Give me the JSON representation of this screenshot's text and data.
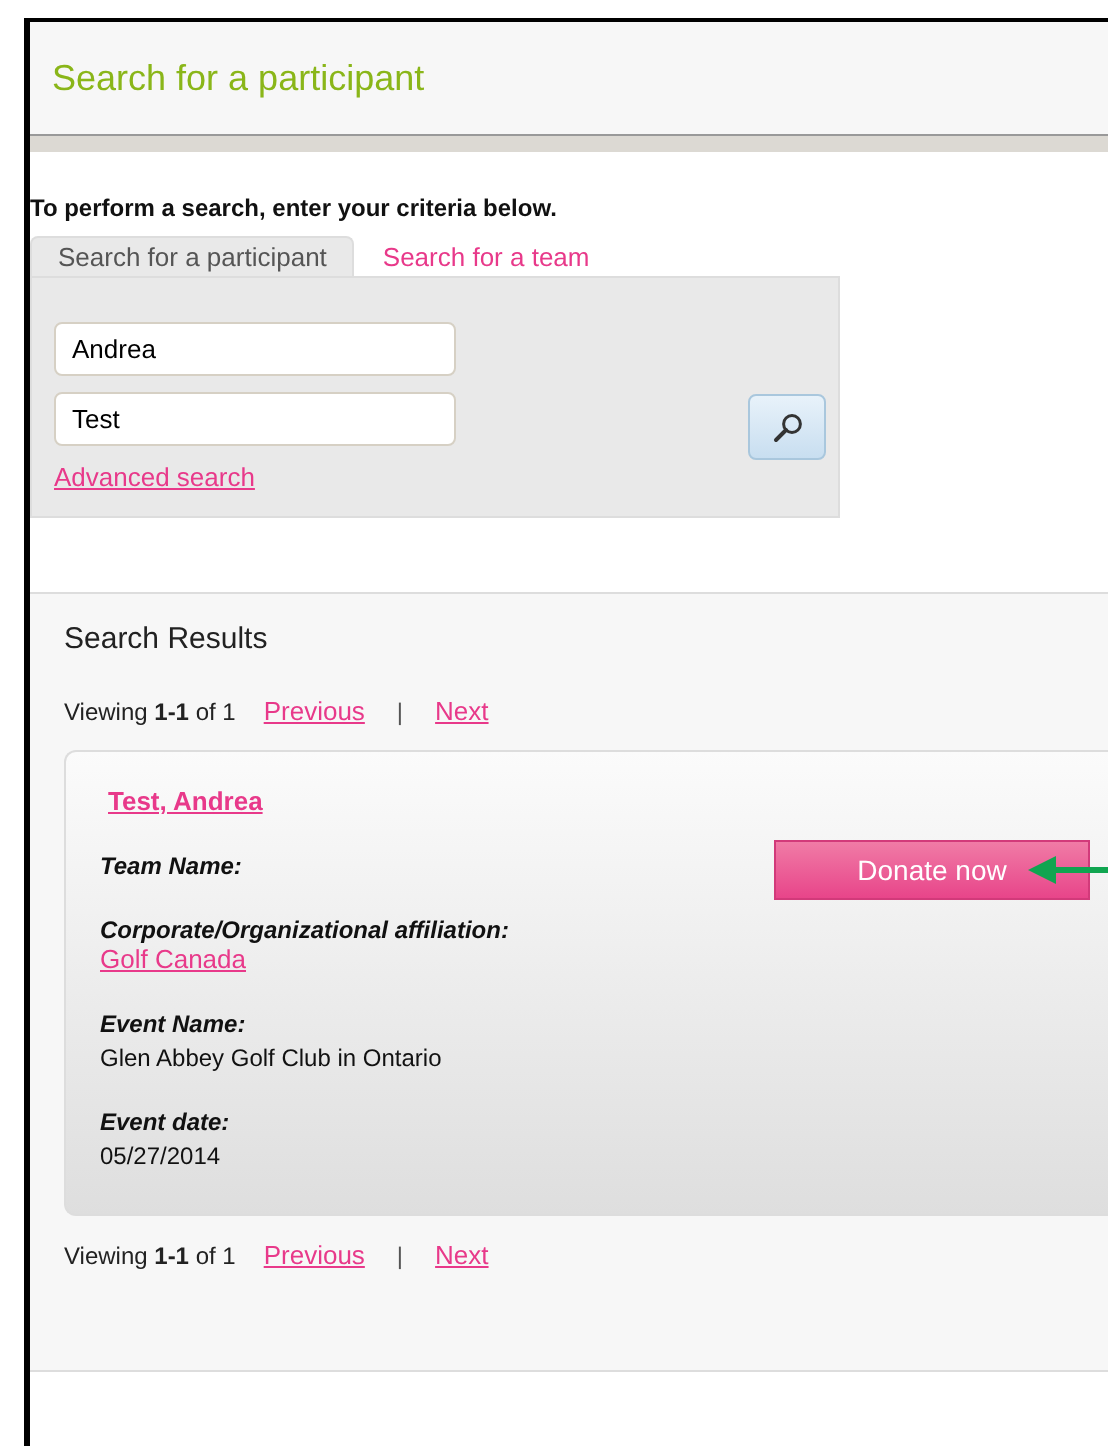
{
  "page_title": "Search for a participant",
  "instructions": "To perform a search, enter your criteria below.",
  "tabs": [
    {
      "label": "Search for a participant",
      "selected": true
    },
    {
      "label": "Search for a team",
      "selected": false
    }
  ],
  "search_form": {
    "first_name": {
      "value": "Andrea"
    },
    "last_name": {
      "value": "Test"
    },
    "advanced_link": "Advanced search"
  },
  "results": {
    "title": "Search Results",
    "pagination_top": {
      "summary": "Viewing **1-1** of 1",
      "previous": "Previous",
      "separator": "|",
      "next": "Next"
    },
    "items": [
      {
        "name": "Test, Andrea",
        "donate_button": "Donate now",
        "fields": [
          {
            "label": "Team Name:"
          },
          {
            "label": "Corporate/Organizational affiliation:",
            "value": "Golf Canada",
            "kind": "link"
          },
          {
            "label": "Event Name:",
            "value": "Glen Abbey Golf Club in Ontario",
            "kind": "text"
          },
          {
            "label": "Event date:",
            "value": "05/27/2014",
            "kind": "text"
          }
        ]
      }
    ],
    "pagination_bottom": {
      "summary": "Viewing **1-1** of 1",
      "previous": "Previous",
      "separator": "|",
      "next": "Next"
    }
  }
}
